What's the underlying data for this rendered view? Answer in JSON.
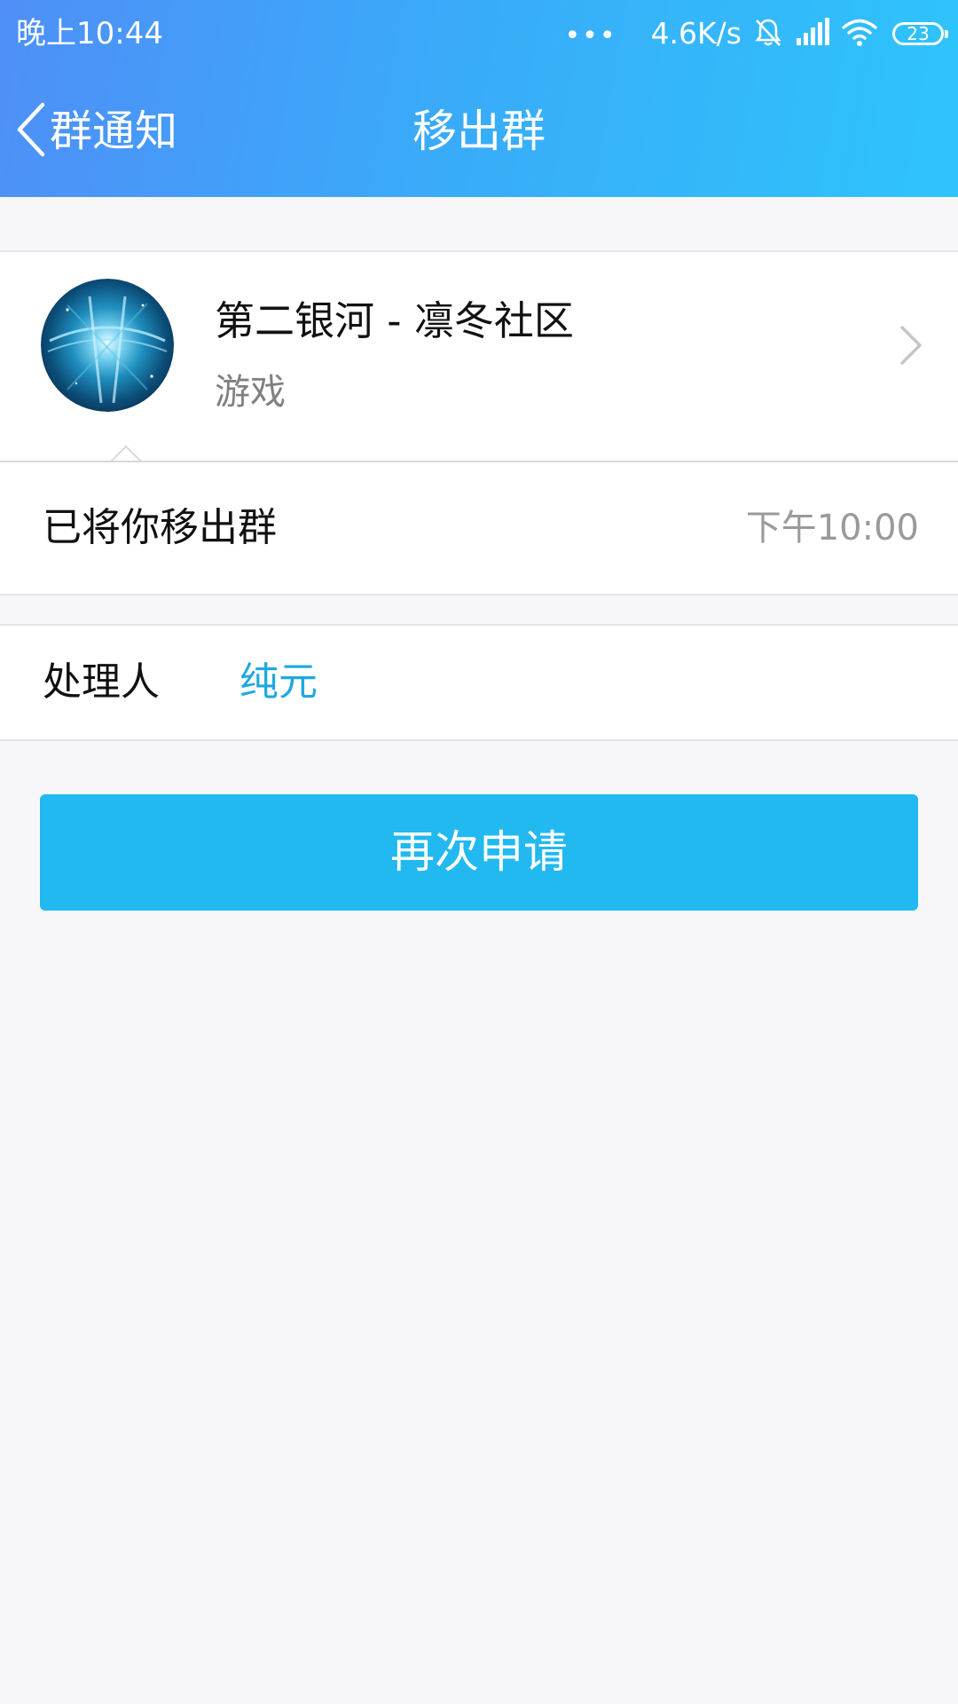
{
  "status_bar": {
    "time": "晚上10:44",
    "dots": "•••",
    "network_speed": "4.6K/s",
    "icons": [
      "mute-bell-icon",
      "cellular-signal-icon",
      "wifi-icon",
      "battery-icon"
    ],
    "battery_level": "23"
  },
  "navbar": {
    "back_label": "群通知",
    "title": "移出群",
    "gradient_colors": [
      "#4f8ff7",
      "#2ec4fb"
    ]
  },
  "group": {
    "name": "第二银河 - 凛冬社区",
    "category": "游戏",
    "avatar_icon": "galaxy-tunnel-avatar"
  },
  "notice": {
    "message": "已将你移出群",
    "time": "下午10:00"
  },
  "handler": {
    "label": "处理人",
    "name": "纯元",
    "name_color": "#1fa8e0"
  },
  "actions": {
    "reapply_label": "再次申请",
    "button_color": "#21b9f0"
  }
}
